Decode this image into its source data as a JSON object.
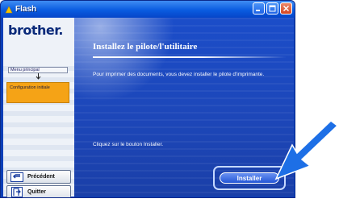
{
  "window": {
    "title": "Flash"
  },
  "sidebar": {
    "logo": "brother.",
    "menu_principal": "Menu principal",
    "current_step": "Configuration initiale",
    "prev_label": "Précédent",
    "quit_label": "Quitter"
  },
  "main": {
    "heading": "Installez le pilote/l'utilitaire",
    "description": "Pour imprimer des documents, vous devez installer le pilote d'imprimante.",
    "instruction": "Cliquez sur le bouton Installer.",
    "install_label": "Installer"
  },
  "colors": {
    "accent": "#1b4dc9",
    "highlight": "#f5a316",
    "callout": "#1d6fe6"
  },
  "icons": [
    "flash-app-icon",
    "minimize-icon",
    "maximize-icon",
    "close-icon",
    "back-arrow-icon",
    "exit-icon",
    "down-arrow-icon",
    "callout-arrow-icon"
  ]
}
